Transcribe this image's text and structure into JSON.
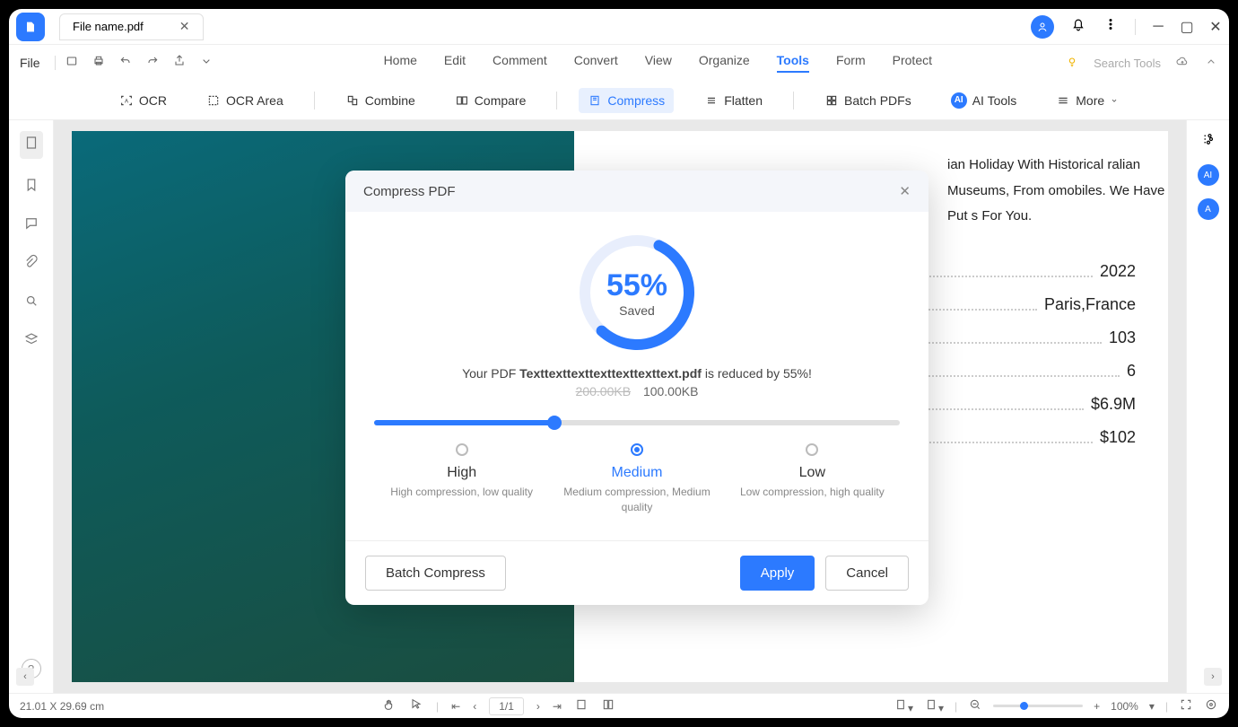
{
  "titlebar": {
    "filename": "File name.pdf"
  },
  "menus": {
    "file": "File",
    "items": [
      "Home",
      "Edit",
      "Comment",
      "Convert",
      "View",
      "Organize",
      "Tools",
      "Form",
      "Protect"
    ],
    "active": "Tools",
    "search_placeholder": "Search Tools"
  },
  "toolbar": {
    "ocr": "OCR",
    "ocr_area": "OCR Area",
    "combine": "Combine",
    "compare": "Compare",
    "compress": "Compress",
    "flatten": "Flatten",
    "batch_pdfs": "Batch PDFs",
    "ai_tools": "AI Tools",
    "more": "More"
  },
  "document": {
    "paragraph_visible": "ian Holiday With Historical ralian Museums, From omobiles. We Have Put s For You.",
    "rows": [
      {
        "value": "2022"
      },
      {
        "value": "Paris,France"
      },
      {
        "value": "103"
      },
      {
        "value": "6"
      },
      {
        "value": "$6.9M"
      },
      {
        "value": "$102"
      }
    ]
  },
  "statusbar": {
    "dimensions": "21.01 X 29.69 cm",
    "page": "1/1",
    "zoom": "100%"
  },
  "modal": {
    "title": "Compress PDF",
    "percent": "55%",
    "saved_label": "Saved",
    "prefix": "Your PDF ",
    "filename": "Texttexttexttexttexttexttext.pdf",
    "suffix": " is reduced by 55%!",
    "old_size": "200.00KB",
    "new_size": "100.00KB",
    "levels": {
      "high": {
        "name": "High",
        "desc": "High compression, low quality"
      },
      "medium": {
        "name": "Medium",
        "desc": "Medium compression, Medium quality"
      },
      "low": {
        "name": "Low",
        "desc": "Low compression, high quality"
      }
    },
    "batch_compress": "Batch Compress",
    "apply": "Apply",
    "cancel": "Cancel"
  }
}
